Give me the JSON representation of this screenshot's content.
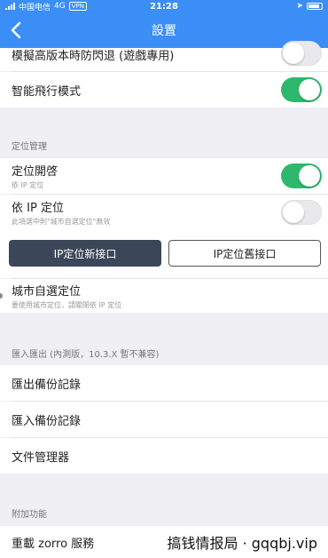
{
  "status_bar": {
    "carrier": "中国电信",
    "network": "4G",
    "vpn": "VPN",
    "time": "21:28"
  },
  "nav": {
    "title": "設置",
    "back_icon": "chevron-left-icon"
  },
  "rows": {
    "prevent_crash": {
      "label": "模擬高版本時防閃退 (遊戲專用)",
      "toggle_on": false
    },
    "smart_airplane": {
      "label": "智能飛行模式",
      "toggle_on": true
    }
  },
  "location": {
    "header": "定位管理",
    "enable": {
      "label": "定位開啓",
      "sub": "依 IP 定位",
      "toggle_on": true
    },
    "by_ip": {
      "label": "依 IP 定位",
      "sub": "此項選中則\"城市自選定位\"無效",
      "toggle_on": false
    },
    "btn_new": "IP定位新接口",
    "btn_old": "IP定位舊接口",
    "city": {
      "label": "城市自選定位",
      "sub": "要使用城市定位，請關閉依 IP 定位"
    }
  },
  "import_export": {
    "header": "匯入匯出 (內測版，10.3.X 暫不兼容)",
    "export_label": "匯出備份記錄",
    "import_label": "匯入備份記錄",
    "files_label": "文件管理器"
  },
  "extras": {
    "header": "附加功能",
    "reload_label": "重載 zorro 服務"
  },
  "watermark": "搞钱情报局 · gqqbj.vip",
  "colors": {
    "accent": "#3a8ef6",
    "toggle_on": "#2db86b",
    "dark_button": "#3b4658"
  }
}
